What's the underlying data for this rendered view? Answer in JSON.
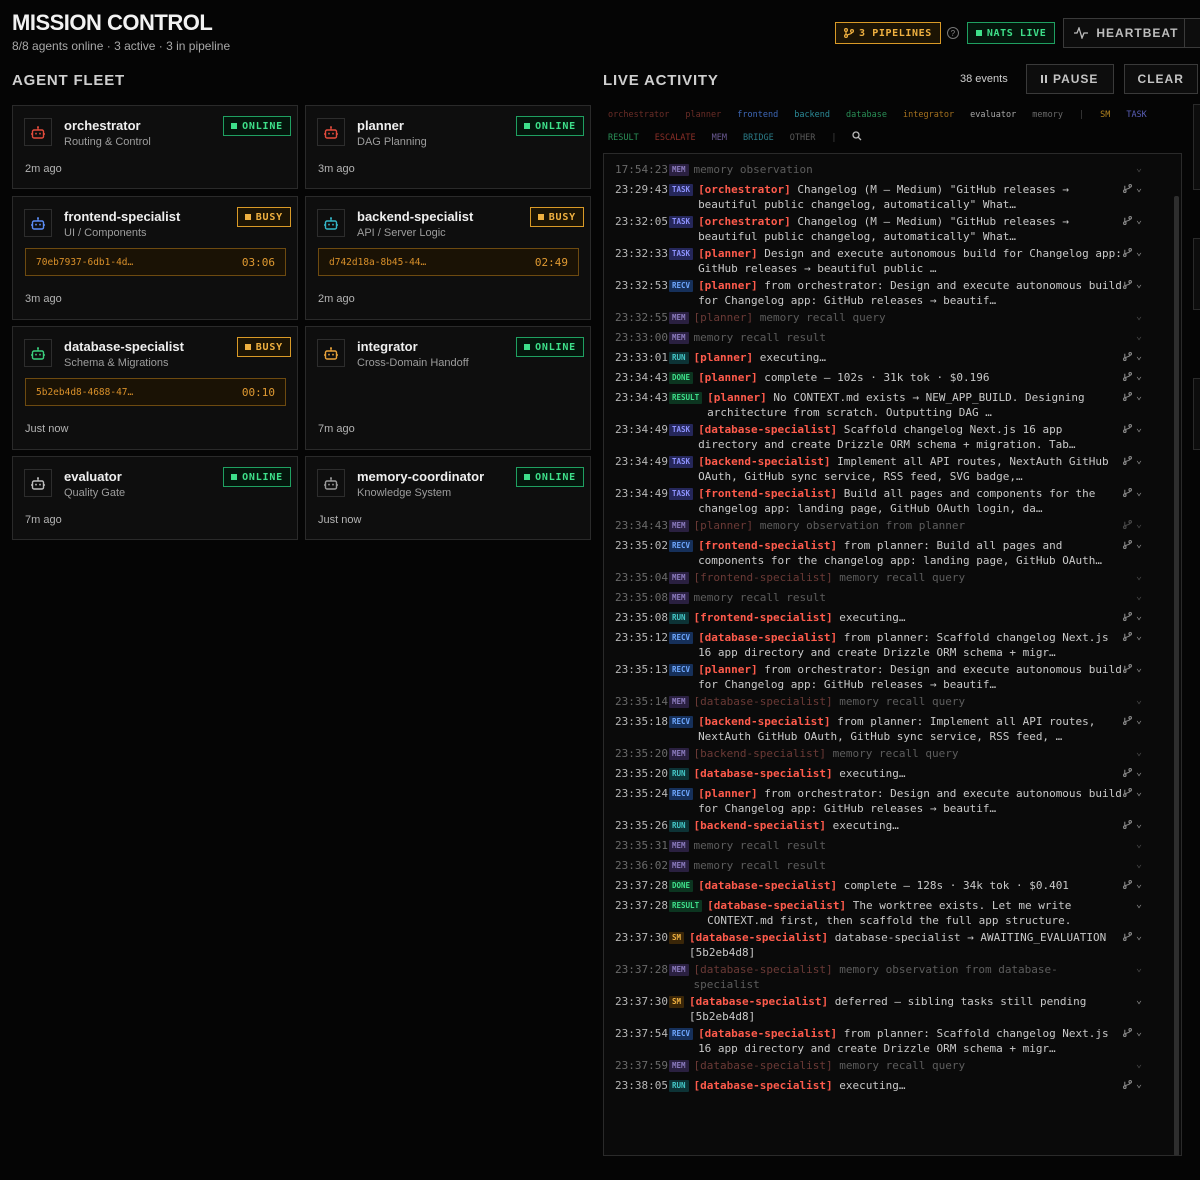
{
  "header": {
    "title": "MISSION CONTROL",
    "subtitle": "8/8 agents online · 3 active · 3 in pipeline",
    "pipelines_label": "3 PIPELINES",
    "nats_label": "NATS LIVE",
    "heartbeat_label": "HEARTBEAT"
  },
  "fleet": {
    "heading": "AGENT FLEET",
    "agents": [
      {
        "name": "orchestrator",
        "role": "Routing & Control",
        "status": "ONLINE",
        "ago": "2m ago",
        "icon_color": "#e24b3c"
      },
      {
        "name": "planner",
        "role": "DAG Planning",
        "status": "ONLINE",
        "ago": "3m ago",
        "icon_color": "#e24b3c"
      },
      {
        "name": "frontend-specialist",
        "role": "UI / Components",
        "status": "BUSY",
        "task_id": "70eb7937-6db1-4d…",
        "task_time": "03:06",
        "ago": "3m ago",
        "icon_color": "#5b8cf5"
      },
      {
        "name": "backend-specialist",
        "role": "API / Server Logic",
        "status": "BUSY",
        "task_id": "d742d18a-8b45-44…",
        "task_time": "02:49",
        "ago": "2m ago",
        "icon_color": "#34b7c9"
      },
      {
        "name": "database-specialist",
        "role": "Schema & Migrations",
        "status": "BUSY",
        "task_id": "5b2eb4d8-4688-47…",
        "task_time": "00:10",
        "ago": "Just now",
        "icon_color": "#3ad07d"
      },
      {
        "name": "integrator",
        "role": "Cross-Domain Handoff",
        "status": "ONLINE",
        "ago": "7m ago",
        "icon_color": "#e8a23a"
      },
      {
        "name": "evaluator",
        "role": "Quality Gate",
        "status": "ONLINE",
        "ago": "7m ago",
        "icon_color": "#bdbdbd"
      },
      {
        "name": "memory-coordinator",
        "role": "Knowledge System",
        "status": "ONLINE",
        "ago": "Just now",
        "icon_color": "#9a9a9a"
      }
    ]
  },
  "activity": {
    "heading": "LIVE ACTIVITY",
    "event_count": "38 events",
    "pause_label": "PAUSE",
    "clear_label": "CLEAR",
    "agent_filters": [
      {
        "label": "orchestrator",
        "color": "#6b2d27"
      },
      {
        "label": "planner",
        "color": "#6b2d27"
      },
      {
        "label": "frontend",
        "color": "#3e68b8"
      },
      {
        "label": "backend",
        "color": "#2b8a97"
      },
      {
        "label": "database",
        "color": "#2a8f57"
      },
      {
        "label": "integrator",
        "color": "#a3701f"
      },
      {
        "label": "evaluator",
        "color": "#a8a8a8"
      },
      {
        "label": "memory",
        "color": "#6a6a6a"
      }
    ],
    "type_filters": [
      {
        "label": "SM",
        "color": "#b0821f"
      },
      {
        "label": "TASK",
        "color": "#5a5fb8"
      },
      {
        "label": "RESULT",
        "color": "#2a8f57"
      },
      {
        "label": "ESCALATE",
        "color": "#8a2f28"
      },
      {
        "label": "MEM",
        "color": "#6b5a94"
      },
      {
        "label": "BRIDGE",
        "color": "#2b7a86"
      },
      {
        "label": "OTHER",
        "color": "#5a5a5a"
      }
    ],
    "events": [
      {
        "time": "17:54:23",
        "tag": "MEM",
        "agent": "",
        "text": "memory observation",
        "dim": true,
        "icon": false
      },
      {
        "time": "23:29:43",
        "tag": "TASK",
        "agent": "[orchestrator]",
        "text": "Changelog (M — Medium) \"GitHub releases → beautiful public changelog, automatically\" What…",
        "dim": false,
        "icon": true
      },
      {
        "time": "23:32:05",
        "tag": "TASK",
        "agent": "[orchestrator]",
        "text": "Changelog (M — Medium) \"GitHub releases → beautiful public changelog, automatically\" What…",
        "dim": false,
        "icon": true
      },
      {
        "time": "23:32:33",
        "tag": "TASK",
        "agent": "[planner]",
        "text": "Design and execute autonomous build for Changelog app: GitHub releases → beautiful public …",
        "dim": false,
        "icon": true
      },
      {
        "time": "23:32:53",
        "tag": "RECV",
        "agent": "[planner]",
        "text": "from orchestrator: Design and execute autonomous build for Changelog app: GitHub releases → beautif…",
        "dim": false,
        "icon": true
      },
      {
        "time": "23:32:55",
        "tag": "MEM",
        "agent": "[planner]",
        "text": "memory recall query",
        "dim": true,
        "icon": false
      },
      {
        "time": "23:33:00",
        "tag": "MEM",
        "agent": "",
        "text": "memory recall result",
        "dim": true,
        "icon": false
      },
      {
        "time": "23:33:01",
        "tag": "RUN",
        "agent": "[planner]",
        "text": "executing…",
        "dim": false,
        "icon": true
      },
      {
        "time": "23:34:43",
        "tag": "DONE",
        "agent": "[planner]",
        "text": "complete — 102s · 31k tok · $0.196",
        "dim": false,
        "icon": true
      },
      {
        "time": "23:34:43",
        "tag": "RESULT",
        "agent": "[planner]",
        "text": "No CONTEXT.md exists → NEW_APP_BUILD. Designing architecture from scratch. Outputting DAG …",
        "dim": false,
        "icon": true
      },
      {
        "time": "23:34:49",
        "tag": "TASK",
        "agent": "[database-specialist]",
        "text": "Scaffold changelog Next.js 16 app directory and create Drizzle ORM schema + migration. Tab…",
        "dim": false,
        "icon": true
      },
      {
        "time": "23:34:49",
        "tag": "TASK",
        "agent": "[backend-specialist]",
        "text": "Implement all API routes, NextAuth GitHub OAuth, GitHub sync service, RSS feed, SVG badge,…",
        "dim": false,
        "icon": true
      },
      {
        "time": "23:34:49",
        "tag": "TASK",
        "agent": "[frontend-specialist]",
        "text": "Build all pages and components for the changelog app: landing page, GitHub OAuth login, da…",
        "dim": false,
        "icon": true
      },
      {
        "time": "23:34:43",
        "tag": "MEM",
        "agent": "[planner]",
        "text": "memory observation from planner",
        "dim": true,
        "icon": true
      },
      {
        "time": "23:35:02",
        "tag": "RECV",
        "agent": "[frontend-specialist]",
        "text": "from planner: Build all pages and components for the changelog app: landing page, GitHub OAuth…",
        "dim": false,
        "icon": true
      },
      {
        "time": "23:35:04",
        "tag": "MEM",
        "agent": "[frontend-specialist]",
        "text": "memory recall query",
        "dim": true,
        "icon": false
      },
      {
        "time": "23:35:08",
        "tag": "MEM",
        "agent": "",
        "text": "memory recall result",
        "dim": true,
        "icon": false
      },
      {
        "time": "23:35:08",
        "tag": "RUN",
        "agent": "[frontend-specialist]",
        "text": "executing…",
        "dim": false,
        "icon": true
      },
      {
        "time": "23:35:12",
        "tag": "RECV",
        "agent": "[database-specialist]",
        "text": "from planner: Scaffold changelog Next.js 16 app directory and create Drizzle ORM schema + migr…",
        "dim": false,
        "icon": true
      },
      {
        "time": "23:35:13",
        "tag": "RECV",
        "agent": "[planner]",
        "text": "from orchestrator: Design and execute autonomous build for Changelog app: GitHub releases → beautif…",
        "dim": false,
        "icon": true
      },
      {
        "time": "23:35:14",
        "tag": "MEM",
        "agent": "[database-specialist]",
        "text": "memory recall query",
        "dim": true,
        "icon": false
      },
      {
        "time": "23:35:18",
        "tag": "RECV",
        "agent": "[backend-specialist]",
        "text": "from planner: Implement all API routes, NextAuth GitHub OAuth, GitHub sync service, RSS feed, …",
        "dim": false,
        "icon": true
      },
      {
        "time": "23:35:20",
        "tag": "MEM",
        "agent": "[backend-specialist]",
        "text": "memory recall query",
        "dim": true,
        "icon": false
      },
      {
        "time": "23:35:20",
        "tag": "RUN",
        "agent": "[database-specialist]",
        "text": "executing…",
        "dim": false,
        "icon": true
      },
      {
        "time": "23:35:24",
        "tag": "RECV",
        "agent": "[planner]",
        "text": "from orchestrator: Design and execute autonomous build for Changelog app: GitHub releases → beautif…",
        "dim": false,
        "icon": true
      },
      {
        "time": "23:35:26",
        "tag": "RUN",
        "agent": "[backend-specialist]",
        "text": "executing…",
        "dim": false,
        "icon": true
      },
      {
        "time": "23:35:31",
        "tag": "MEM",
        "agent": "",
        "text": "memory recall result",
        "dim": true,
        "icon": false
      },
      {
        "time": "23:36:02",
        "tag": "MEM",
        "agent": "",
        "text": "memory recall result",
        "dim": true,
        "icon": false
      },
      {
        "time": "23:37:28",
        "tag": "DONE",
        "agent": "[database-specialist]",
        "text": "complete — 128s · 34k tok · $0.401",
        "dim": false,
        "icon": true
      },
      {
        "time": "23:37:28",
        "tag": "RESULT",
        "agent": "[database-specialist]",
        "text": "The worktree exists. Let me write CONTEXT.md first, then scaffold the full app structure.",
        "dim": false,
        "icon": false
      },
      {
        "time": "23:37:30",
        "tag": "SM",
        "agent": "[database-specialist]",
        "text": "database-specialist → AWAITING_EVALUATION [5b2eb4d8]",
        "dim": false,
        "icon": true
      },
      {
        "time": "23:37:28",
        "tag": "MEM",
        "agent": "[database-specialist]",
        "text": "memory observation from database-specialist",
        "dim": true,
        "icon": false
      },
      {
        "time": "23:37:30",
        "tag": "SM",
        "agent": "[database-specialist]",
        "text": "deferred — sibling tasks still pending [5b2eb4d8]",
        "dim": false,
        "icon": false
      },
      {
        "time": "23:37:54",
        "tag": "RECV",
        "agent": "[database-specialist]",
        "text": "from planner: Scaffold changelog Next.js 16 app directory and create Drizzle ORM schema + migr…",
        "dim": false,
        "icon": true
      },
      {
        "time": "23:37:59",
        "tag": "MEM",
        "agent": "[database-specialist]",
        "text": "memory recall query",
        "dim": true,
        "icon": false
      },
      {
        "time": "23:38:05",
        "tag": "RUN",
        "agent": "[database-specialist]",
        "text": "executing…",
        "dim": false,
        "icon": true
      }
    ]
  }
}
